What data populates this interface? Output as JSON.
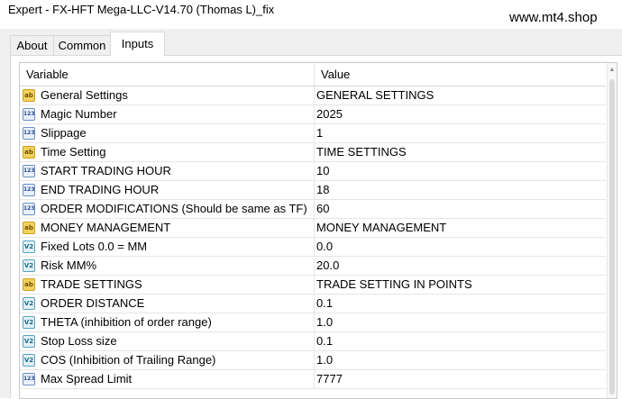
{
  "window": {
    "title": "Expert - FX-HFT Mega-LLC-V14.70 (Thomas L)_fix",
    "watermark": "www.mt4.shop"
  },
  "tabs": [
    {
      "label": "About",
      "active": false
    },
    {
      "label": "Common",
      "active": false
    },
    {
      "label": "Inputs",
      "active": true
    }
  ],
  "table": {
    "columns": [
      "Variable",
      "Value"
    ],
    "rows": [
      {
        "icon": "ab",
        "variable": "General Settings",
        "value": "GENERAL SETTINGS"
      },
      {
        "icon": "123",
        "variable": "Magic Number",
        "value": "2025"
      },
      {
        "icon": "123",
        "variable": "Slippage",
        "value": "1"
      },
      {
        "icon": "ab",
        "variable": "Time Setting",
        "value": "TIME SETTINGS"
      },
      {
        "icon": "123",
        "variable": "START TRADING HOUR",
        "value": "10"
      },
      {
        "icon": "123",
        "variable": "END TRADING HOUR",
        "value": "18"
      },
      {
        "icon": "123",
        "variable": "ORDER MODIFICATIONS (Should be same as TF)",
        "value": "60"
      },
      {
        "icon": "ab",
        "variable": "MONEY MANAGEMENT",
        "value": "MONEY MANAGEMENT"
      },
      {
        "icon": "v2",
        "variable": "Fixed Lots 0.0 = MM",
        "value": "0.0"
      },
      {
        "icon": "v2",
        "variable": "Risk MM%",
        "value": "20.0"
      },
      {
        "icon": "ab",
        "variable": "TRADE SETTINGS",
        "value": "TRADE SETTING IN POINTS"
      },
      {
        "icon": "v2",
        "variable": "ORDER DISTANCE",
        "value": "0.1"
      },
      {
        "icon": "v2",
        "variable": "THETA (inhibition of order range)",
        "value": "1.0"
      },
      {
        "icon": "v2",
        "variable": "Stop Loss size",
        "value": "0.1"
      },
      {
        "icon": "v2",
        "variable": "COS (Inhibition of Trailing Range)",
        "value": "1.0"
      },
      {
        "icon": "123",
        "variable": "Max Spread Limit",
        "value": "7777"
      }
    ]
  },
  "icon_glyphs": {
    "ab": "ab",
    "123": "123",
    "v2": "V2"
  },
  "colors": {
    "panel_background": "#f0f0f0",
    "grid_border": "#c9c9c9",
    "string_icon": "#f3d25a",
    "int_icon": "#6d8fc2",
    "double_icon": "#5aa1bd"
  }
}
